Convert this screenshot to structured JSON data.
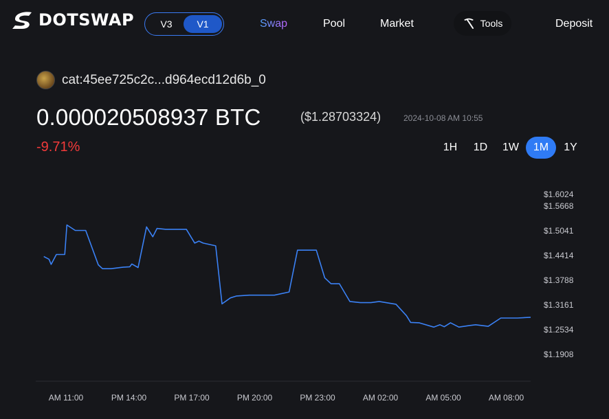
{
  "header": {
    "logo_text": "DOTSWAP",
    "versions": [
      "V3",
      "V1"
    ],
    "active_version": "V1",
    "nav": {
      "swap": "Swap",
      "pool": "Pool",
      "market": "Market",
      "tools": "Tools",
      "deposit": "Deposit"
    }
  },
  "token": {
    "name": "cat:45ee725c2c...d964ecd12d6b_0",
    "price_btc": "0.000020508937 BTC",
    "price_usd": "($1.28703324)",
    "timestamp": "2024-10-08 AM 10:55",
    "change": "-9.71%"
  },
  "ranges": [
    "1H",
    "1D",
    "1W",
    "1M",
    "1Y"
  ],
  "active_range": "1M",
  "colors": {
    "accent": "#2f7bf5",
    "line": "#3b82f6",
    "negative": "#f23a3a",
    "background": "#16171b"
  },
  "chart_data": {
    "type": "line",
    "ytick_labels": [
      "$1.6024",
      "$1.5668",
      "$1.5041",
      "$1.4414",
      "$1.3788",
      "$1.3161",
      "$1.2534",
      "$1.1908"
    ],
    "ytick_values": [
      1.6024,
      1.5668,
      1.5041,
      1.4414,
      1.3788,
      1.3161,
      1.2534,
      1.1908
    ],
    "xtick_labels": [
      "AM 11:00",
      "PM 14:00",
      "PM 17:00",
      "PM 20:00",
      "PM 23:00",
      "AM 02:00",
      "AM 05:00",
      "AM 08:00"
    ],
    "xtick_hours": [
      0,
      3,
      6,
      9,
      12,
      15,
      18,
      21
    ],
    "series": [
      {
        "x": [
          -0.6,
          -0.35,
          -0.25,
          0.0,
          0.4,
          0.5,
          0.9,
          1.0,
          1.4,
          2.0,
          2.2,
          2.5,
          2.6,
          3.2,
          3.5,
          3.6,
          3.9,
          4.3,
          4.6,
          4.8,
          5.2,
          5.3,
          6.2,
          6.6,
          6.8,
          7.0,
          7.6,
          7.9,
          8.3,
          8.6,
          9.2,
          9.5,
          10.4,
          11.1,
          11.5,
          12.4,
          12.8,
          13.1,
          13.5,
          14.0,
          14.5,
          15.0,
          15.4,
          16.2,
          16.7,
          16.9,
          17.3,
          18.0,
          18.3,
          18.5,
          18.8,
          19.2,
          19.7,
          20.0,
          20.6,
          21.2,
          22.0,
          23.5
        ],
        "y": [
          1.439,
          1.432,
          1.419,
          1.444,
          1.444,
          1.519,
          1.505,
          1.505,
          1.505,
          1.418,
          1.408,
          1.408,
          1.408,
          1.412,
          1.413,
          1.42,
          1.411,
          1.514,
          1.489,
          1.51,
          1.508,
          1.508,
          1.508,
          1.473,
          1.478,
          1.473,
          1.466,
          1.319,
          1.334,
          1.339,
          1.341,
          1.341,
          1.341,
          1.349,
          1.455,
          1.455,
          1.385,
          1.37,
          1.37,
          1.325,
          1.322,
          1.322,
          1.325,
          1.318,
          1.289,
          1.272,
          1.271,
          1.26,
          1.266,
          1.261,
          1.271,
          1.26,
          1.264,
          1.266,
          1.262,
          1.283,
          1.283,
          1.285
        ]
      }
    ]
  }
}
